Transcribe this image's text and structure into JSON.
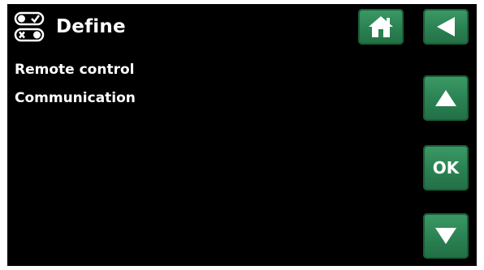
{
  "header": {
    "title": "Define",
    "icon": "toggle-switches-icon"
  },
  "menu": {
    "items": [
      {
        "label": "Remote control"
      },
      {
        "label": "Communication"
      }
    ]
  },
  "buttons": {
    "home_icon": "home-icon",
    "back_icon": "back-arrow-icon",
    "up_icon": "arrow-up-icon",
    "ok_label": "OK",
    "down_icon": "arrow-down-icon"
  },
  "colors": {
    "background": "#000000",
    "text": "#ffffff",
    "button": "#2a8152"
  }
}
